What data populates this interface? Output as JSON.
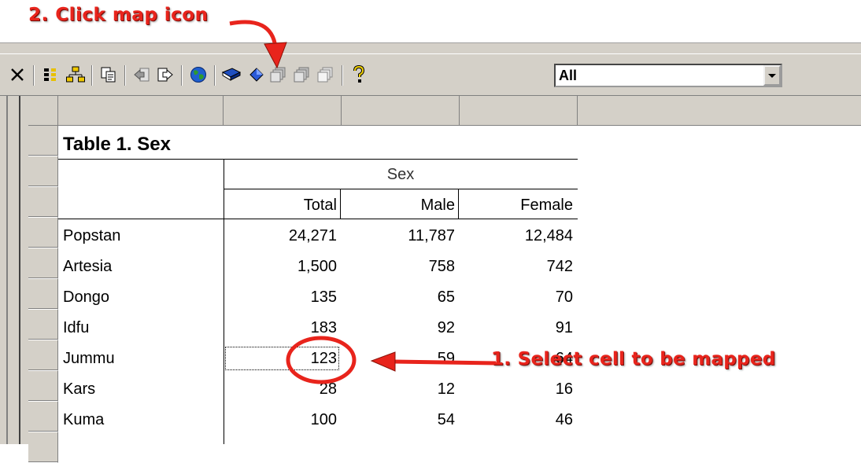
{
  "annotations": {
    "step2": "2. Click map icon",
    "step1": "1. Select cell to be mapped",
    "color": "#e8241c"
  },
  "toolbar": {
    "buttons": [
      {
        "name": "close-icon",
        "glyph": "✕"
      },
      {
        "name": "pivot-rows-icon",
        "glyph": "grid"
      },
      {
        "name": "hierarchy-icon",
        "glyph": "tree"
      },
      {
        "name": "copy-icon",
        "glyph": "copy"
      },
      {
        "name": "back-icon",
        "glyph": "back"
      },
      {
        "name": "forward-icon",
        "glyph": "forward"
      },
      {
        "name": "map-globe-icon",
        "glyph": "globe"
      },
      {
        "name": "book-icon",
        "glyph": "book"
      },
      {
        "name": "diamond-icon",
        "glyph": "diamond"
      },
      {
        "name": "stack-icon-1",
        "glyph": "stack"
      },
      {
        "name": "stack-icon-2",
        "glyph": "stack"
      },
      {
        "name": "stack-icon-3",
        "glyph": "stack"
      },
      {
        "name": "help-icon",
        "glyph": "?"
      }
    ],
    "filter_value": "All"
  },
  "table": {
    "title": "Table 1. Sex",
    "group_header": "Sex",
    "columns": [
      "Total",
      "Male",
      "Female"
    ],
    "rows": [
      {
        "area": "Popstan",
        "total": "24,271",
        "male": "11,787",
        "female": "12,484"
      },
      {
        "area": "Artesia",
        "total": "1,500",
        "male": "758",
        "female": "742"
      },
      {
        "area": "Dongo",
        "total": "135",
        "male": "65",
        "female": "70"
      },
      {
        "area": "Idfu",
        "total": "183",
        "male": "92",
        "female": "91"
      },
      {
        "area": "Jummu",
        "total": "123",
        "male": "59",
        "female": "64"
      },
      {
        "area": "Kars",
        "total": "28",
        "male": "12",
        "female": "16"
      },
      {
        "area": "Kuma",
        "total": "100",
        "male": "54",
        "female": "46"
      }
    ],
    "selected_cell": "123"
  }
}
